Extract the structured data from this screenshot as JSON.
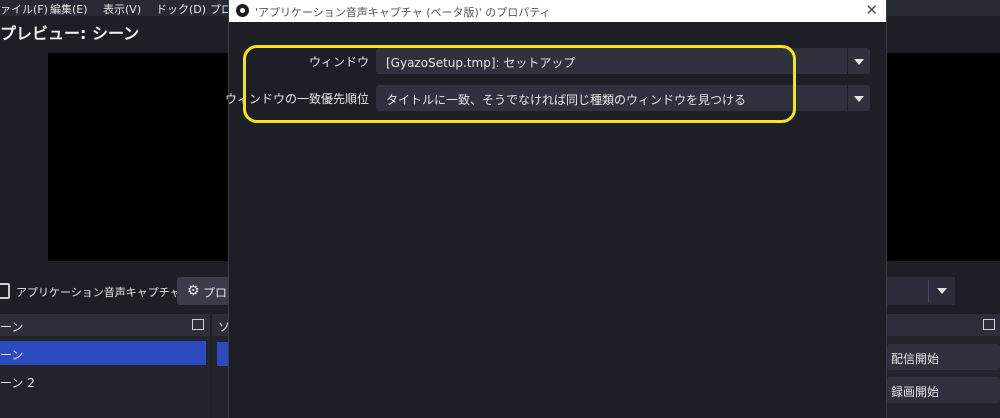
{
  "menu": [
    "ァイル(F)",
    "編集(E)",
    "表示(V)",
    "ドック(D)",
    "プロ"
  ],
  "preview": {
    "title": "プレビュー: シーン"
  },
  "source_toolbar": {
    "source_name": "アプリケーション音声キャプチャ(/",
    "properties_label": "プロパ"
  },
  "scenes_dock": {
    "title": "ーン",
    "items": [
      "ーン",
      "ーン 2"
    ]
  },
  "sources_dock": {
    "title": "ソ"
  },
  "controls_dock": {
    "buttons": [
      "配信開始",
      "録画開始"
    ]
  },
  "dialog": {
    "title": "'アプリケーション音声キャプチャ (ベータ版)' のプロパティ",
    "close": "✕",
    "fields": [
      {
        "label": "ウィンドウ",
        "value": "[GyazoSetup.tmp]: セットアップ"
      },
      {
        "label": "ウィンドウの一致優先順位",
        "value": "タイトルに一致、そうでなければ同じ種類のウィンドウを見つける"
      }
    ]
  },
  "colors": {
    "background": "#1e1f26",
    "accent_selected": "#2c4bc0",
    "highlight": "#f4e21a"
  }
}
